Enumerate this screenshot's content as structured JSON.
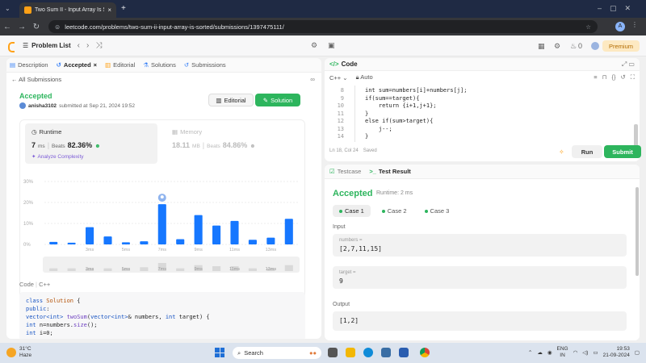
{
  "browser": {
    "tab_title": "Two Sum II - Input Array Is Sorte",
    "tab_close": "×",
    "new_tab": "+",
    "url": "leetcode.com/problems/two-sum-ii-input-array-is-sorted/submissions/1397475111/"
  },
  "lc_header": {
    "problem_list": "Problem List",
    "premium": "Premium",
    "streak": "0"
  },
  "left_tabs": [
    "Description",
    "Accepted",
    "Editorial",
    "Solutions",
    "Submissions"
  ],
  "submission": {
    "all_submissions": "All Submissions",
    "status": "Accepted",
    "user": "anisha3102",
    "submitted_at": "submitted at Sep 21, 2024 19:52",
    "editorial_btn": "Editorial",
    "solution_btn": "Solution"
  },
  "runtime": {
    "title": "Runtime",
    "value": "7",
    "unit": "ms",
    "beats_label": "Beats",
    "beats_pct": "82.36%",
    "analyze": "Analyze Complexity"
  },
  "memory": {
    "title": "Memory",
    "value": "18.11",
    "unit": "MB",
    "beats_label": "Beats",
    "beats_pct": "84.86%"
  },
  "chart_data": {
    "type": "bar",
    "y_ticks": [
      "30%",
      "20%",
      "10%",
      "0%"
    ],
    "ylim": [
      0,
      30
    ],
    "values": [
      1.2,
      0.8,
      8.2,
      3.8,
      1.0,
      1.5,
      19.2,
      2.5,
      14,
      9,
      11.2,
      2.2,
      3.2,
      12.2
    ],
    "highlight_index": 6,
    "x_labels": [
      "3ms",
      "5ms",
      "7ms",
      "9ms",
      "11ms",
      "13ms"
    ],
    "mini_labels": [
      "3ms",
      "5ms",
      "7ms",
      "9ms",
      "11ms",
      "13ms"
    ],
    "mini_values": [
      1,
      1,
      1,
      1,
      1,
      2,
      6,
      1,
      4,
      3,
      3,
      1,
      1,
      4
    ]
  },
  "code_section": {
    "label": "Code",
    "lang": "C++",
    "lines": [
      "class Solution {",
      "public:",
      "    vector<int> twoSum(vector<int>& numbers, int target) {",
      "        int n=numbers.size();",
      "        int i=0;"
    ]
  },
  "editor": {
    "title": "Code",
    "lang": "C++",
    "mode": "Auto",
    "line_numbers": [
      "8",
      "9",
      "10",
      "11",
      "12",
      "13",
      "14"
    ],
    "lines": [
      "int sum=numbers[i]+numbers[j];",
      "if(sum==target){",
      "    return {i+1,j+1};",
      "}",
      "else if(sum>target){",
      "    j--;",
      "}"
    ],
    "cursor": "Ln 18, Col 24",
    "saved": "Saved",
    "run": "Run",
    "submit": "Submit"
  },
  "result": {
    "tab_testcase": "Testcase",
    "tab_result": "Test Result",
    "status": "Accepted",
    "runtime": "Runtime: 2 ms",
    "cases": [
      "Case 1",
      "Case 2",
      "Case 3"
    ],
    "input_label": "Input",
    "numbers_label": "numbers =",
    "numbers_value": "[2,7,11,15]",
    "target_label": "target =",
    "target_value": "9",
    "output_label": "Output",
    "output_value": "[1,2]"
  },
  "taskbar": {
    "temp": "31°C",
    "weather": "Haze",
    "search": "Search",
    "lang": "ENG",
    "region": "IN",
    "time": "19:53",
    "date": "21-09-2024"
  },
  "colors": {
    "accent_green": "#2db55d",
    "bar_blue": "#1677ff",
    "brand_orange": "#ffa116"
  }
}
